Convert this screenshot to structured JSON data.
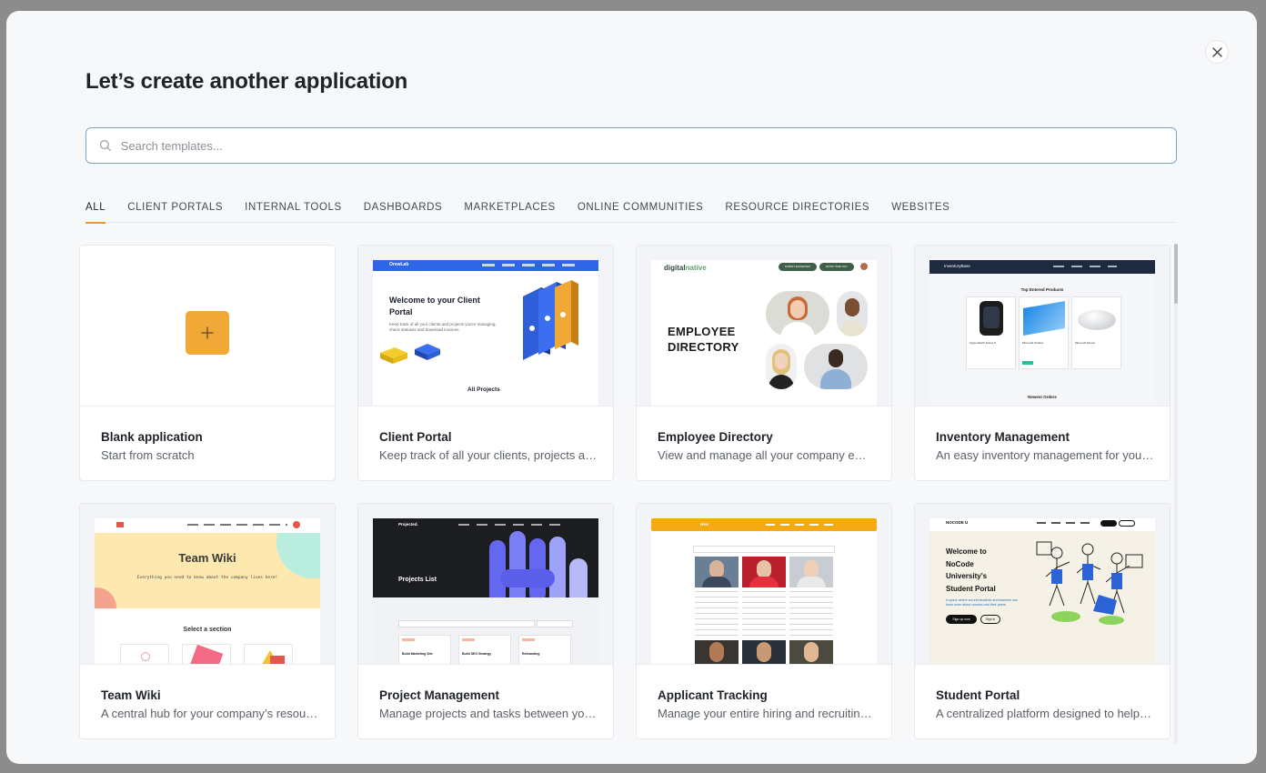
{
  "modal": {
    "title": "Let’s create another application",
    "search_placeholder": "Search templates...",
    "close_icon": "close-icon"
  },
  "tabs": [
    {
      "label": "ALL",
      "active": true
    },
    {
      "label": "CLIENT PORTALS",
      "active": false
    },
    {
      "label": "INTERNAL TOOLS",
      "active": false
    },
    {
      "label": "DASHBOARDS",
      "active": false
    },
    {
      "label": "MARKETPLACES",
      "active": false
    },
    {
      "label": "ONLINE COMMUNITIES",
      "active": false
    },
    {
      "label": "RESOURCE DIRECTORIES",
      "active": false
    },
    {
      "label": "WEBSITES",
      "active": false
    }
  ],
  "templates": [
    {
      "title": "Blank application",
      "desc": "Start from scratch"
    },
    {
      "title": "Client Portal",
      "desc": "Keep track of all your clients, projects and invoices"
    },
    {
      "title": "Employee Directory",
      "desc": "View and manage all your company employees"
    },
    {
      "title": "Inventory Management",
      "desc": "An easy inventory management for your products"
    },
    {
      "title": "Team Wiki",
      "desc": "A central hub for your company’s resources"
    },
    {
      "title": "Project Management",
      "desc": "Manage projects and tasks between your team"
    },
    {
      "title": "Applicant Tracking",
      "desc": "Manage your entire hiring and recruiting process"
    },
    {
      "title": "Student Portal",
      "desc": "A centralized platform designed to help students"
    }
  ],
  "previews": {
    "client_portal": {
      "brand": "OrewLab",
      "heading": "Welcome to your Client Portal",
      "sub": "Keep track of all your clients and projects you're managing, check statuses and download invoices.",
      "section": "All Projects"
    },
    "employee_directory": {
      "brand_a": "digital",
      "brand_b": "native",
      "heading_line1": "EMPLOYEE",
      "heading_line2": "DIRECTORY",
      "btn1": "SUBMIT EXPENSES",
      "btn2": "BOOK TIME OFF"
    },
    "inventory": {
      "brand": "InventoryBase",
      "section": "Top Entered Products",
      "section2": "Newest Orders",
      "items": [
        "Apple Watch Series 8",
        "Microsoft Surface",
        "Microsoft Mouse"
      ]
    },
    "team_wiki": {
      "heading": "Team Wiki",
      "sub": "Everything you need to know about the company lives here!",
      "section": "Select a section"
    },
    "project_mgmt": {
      "brand": "Projected.",
      "heading": "Projects List",
      "cards": [
        "Build Marketing Site",
        "Build SEO Strategy",
        "Rebranding"
      ]
    },
    "applicant": {
      "brand": "Hire"
    },
    "student": {
      "brand": "NOCODE U",
      "heading": "Welcome to NoCode University’s Student Portal",
      "sub": "A space where current students and teachers can learn more about courses and their peers.",
      "btn1": "Sign up now",
      "btn2": "Sign in"
    }
  },
  "colors": {
    "accent": "#e59a2f",
    "plus_tile": "#f0a937",
    "title": "#1f2329"
  }
}
